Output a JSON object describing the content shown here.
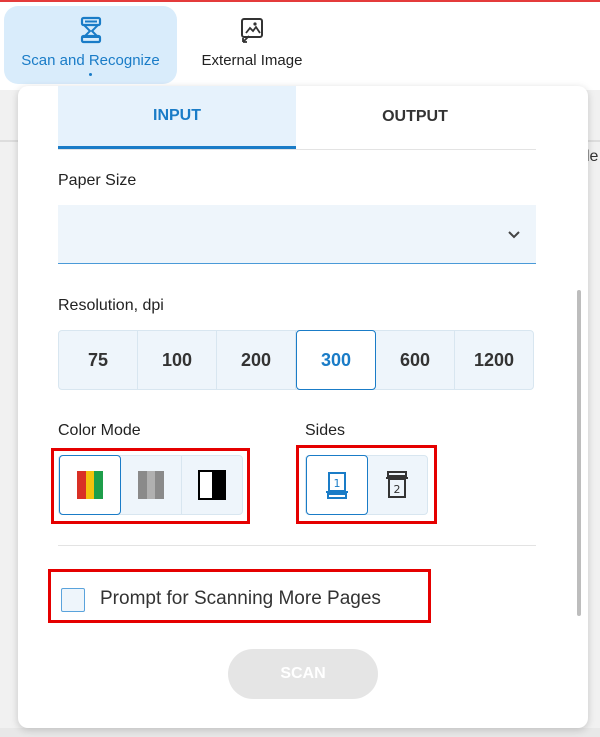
{
  "toolbar": {
    "scan_label": "Scan and Recognize",
    "external_label": "External Image"
  },
  "tabs": {
    "input": "INPUT",
    "output": "OUTPUT"
  },
  "paper_size": {
    "label": "Paper Size",
    "value": ""
  },
  "resolution": {
    "label": "Resolution, dpi",
    "options": [
      "75",
      "100",
      "200",
      "300",
      "600",
      "1200"
    ],
    "selected": "300"
  },
  "color_mode": {
    "label": "Color Mode",
    "options": [
      "color",
      "grayscale",
      "black-white"
    ],
    "selected": "color"
  },
  "sides": {
    "label": "Sides",
    "options": [
      "1",
      "2"
    ],
    "selected": "1"
  },
  "prompt": {
    "label": "Prompt for Scanning More Pages",
    "checked": false
  },
  "scan_button": "SCAN",
  "background_fragment": "le",
  "colors": {
    "accent": "#1a7cc7",
    "highlight": "#e50000",
    "disabled": "#e5e5e5"
  }
}
